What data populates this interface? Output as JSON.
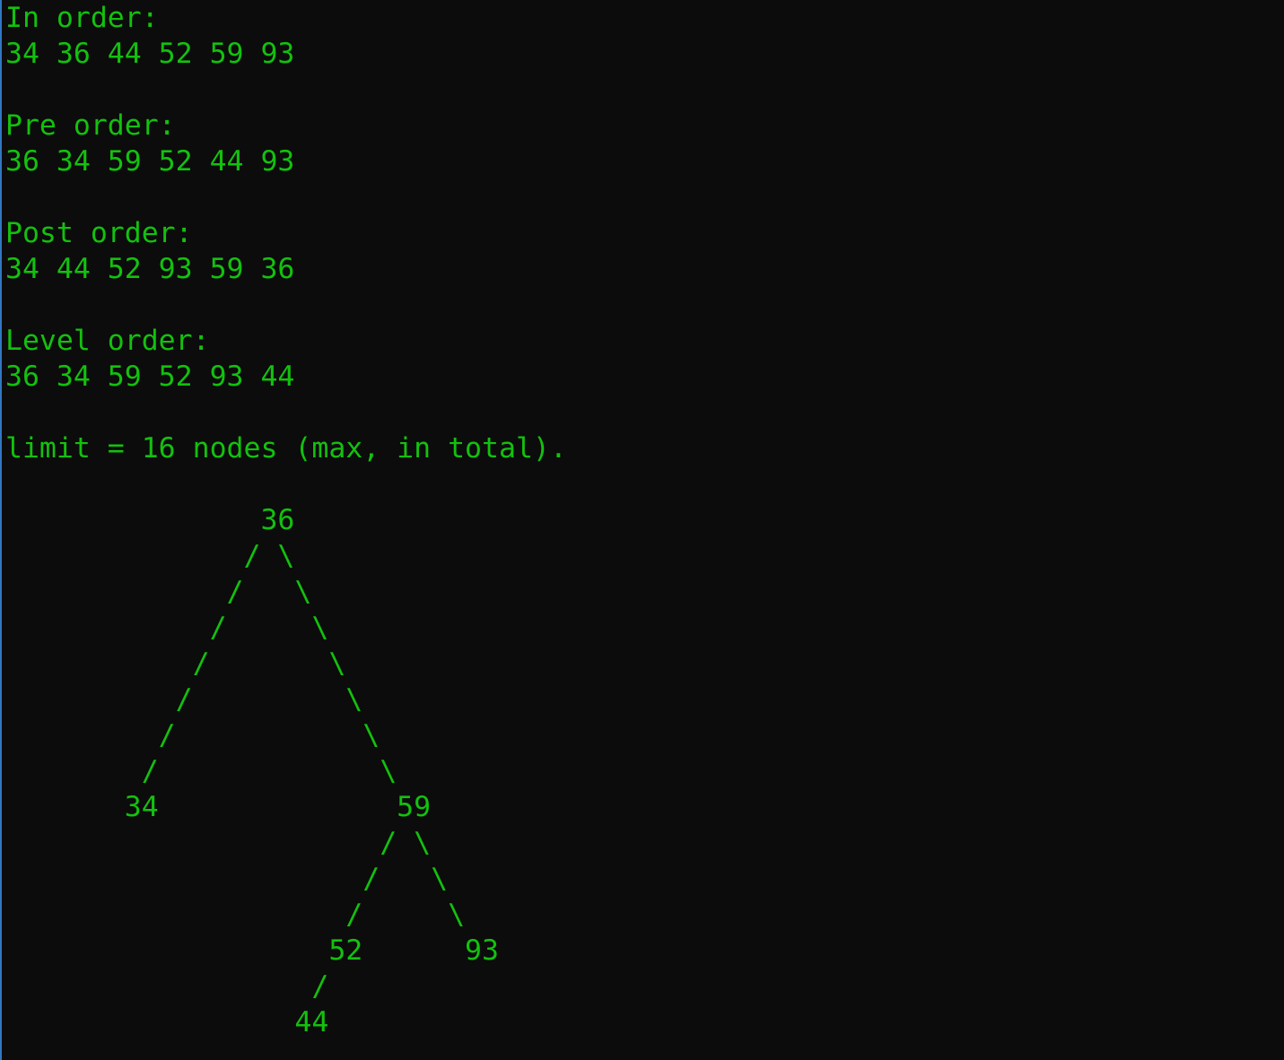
{
  "theme": {
    "background": "#0c0c0c",
    "foreground": "#13c10e",
    "border": "#2f78c4"
  },
  "output": {
    "inorder_label": "In order:",
    "inorder_values": "34 36 44 52 59 93",
    "preorder_label": "Pre order:",
    "preorder_values": "36 34 59 52 44 93",
    "postorder_label": "Post order:",
    "postorder_values": "34 44 52 93 59 36",
    "levelorder_label": "Level order:",
    "levelorder_values": "36 34 59 52 93 44",
    "limit_text": "limit = 16 nodes (max, in total)."
  },
  "tree_lines": [
    "               36",
    "              / \\",
    "             /   \\",
    "            /     \\",
    "           /       \\",
    "          /         \\",
    "         /           \\",
    "        /             \\",
    "       34              59",
    "                      / \\",
    "                     /   \\",
    "                    /     \\",
    "                   52      93",
    "                  /",
    "                 44"
  ]
}
